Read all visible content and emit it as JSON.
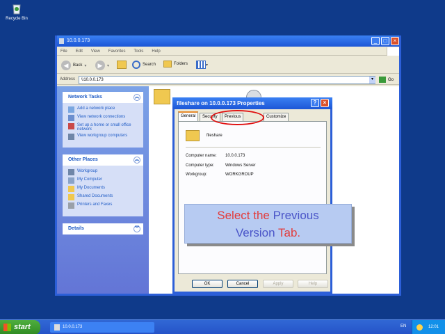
{
  "desktop": {
    "recycle_bin_label": "Recycle Bin"
  },
  "explorer": {
    "title": "10.0.0.173",
    "menu": [
      "File",
      "Edit",
      "View",
      "Favorites",
      "Tools",
      "Help"
    ],
    "toolbar": {
      "back": "Back",
      "search": "Search",
      "folders": "Folders"
    },
    "address_label": "Address",
    "address_value": "\\\\10.0.0.173",
    "go_label": "Go",
    "network_tasks": {
      "title": "Network Tasks",
      "items": [
        "Add a network place",
        "View network connections",
        "Set up a home or small office network",
        "View workgroup computers"
      ]
    },
    "other_places": {
      "title": "Other Places",
      "items": [
        "Workgroup",
        "My Computer",
        "My Documents",
        "Shared Documents",
        "Printers and Faxes"
      ]
    },
    "details": {
      "title": "Details"
    }
  },
  "dialog": {
    "title": "fileshare on 10.0.0.173 Properties",
    "tabs": [
      "General",
      "Security",
      "Previous Versions",
      "Customize"
    ],
    "folder_name": "fileshare",
    "computer_name_label": "Computer name:",
    "computer_name_value": "10.0.0.173",
    "computer_type_label": "Computer type:",
    "computer_type_value": "Windows Server",
    "workgroup_label": "Workgroup:",
    "workgroup_value": "WORKGROUP",
    "ok_label": "OK",
    "cancel_label": "Cancel",
    "apply_label": "Apply",
    "help_label": "Help"
  },
  "callout": {
    "w1": "Select the",
    "w2": "Previous",
    "w3": "Version",
    "w4": "Tab."
  },
  "taskbar": {
    "start_label": "start",
    "task_label": "10.0.0.173",
    "language": "EN",
    "clock": "12:01"
  },
  "colors": {
    "title_blue": "#2c5fd8",
    "desktop": "#0f3a8a",
    "highlight_red": "#e01010",
    "callout_bg": "#b7cbf2"
  }
}
